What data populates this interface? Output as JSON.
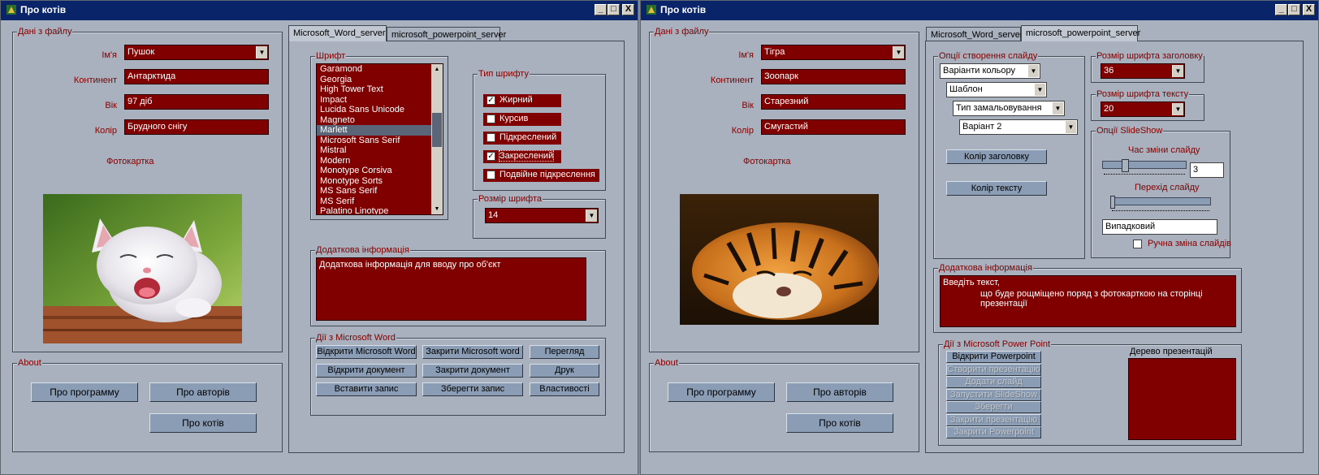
{
  "window_title": "Про котів",
  "window_controls": {
    "minimize": "_",
    "maximize": "□",
    "close": "X"
  },
  "left": {
    "file_group": {
      "title": "Дані з файлу",
      "name_label": "Ім'я",
      "name_value": "Пушок",
      "continent_label": "Континент",
      "continent_value": "Антарктида",
      "age_label": "Вік",
      "age_value": "97 діб",
      "color_label": "Колір",
      "color_value": "Брудного снігу",
      "photo_label": "Фотокартка"
    },
    "about": {
      "title": "About",
      "btn_program": "Про программу",
      "btn_authors": "Про авторів",
      "btn_cats": "Про котів"
    },
    "tabs": [
      "Microsoft_Word_server",
      "microsoft_powerpoint_server"
    ],
    "font_group": {
      "title": "Шрифт",
      "fonts": [
        "Garamond",
        "Georgia",
        "High Tower Text",
        "Impact",
        "Lucida Sans Unicode",
        "Magneto",
        "Marlett",
        "Microsoft Sans Serif",
        "Mistral",
        "Modern",
        "Monotype Corsiva",
        "Monotype Sorts",
        "MS Sans Serif",
        "MS Serif",
        "Palatino Linotype"
      ],
      "selected": "Marlett"
    },
    "font_type": {
      "title": "Тип шрифту",
      "options": [
        {
          "label": "Жирний",
          "checked": true
        },
        {
          "label": "Курсив",
          "checked": false
        },
        {
          "label": "Підкреслений",
          "checked": false
        },
        {
          "label": "Закреслений",
          "checked": true
        },
        {
          "label": "Подвійне підкреслення",
          "checked": false
        }
      ]
    },
    "font_size": {
      "title": "Розмір шрифта",
      "value": "14"
    },
    "extra": {
      "title": "Додаткова інформація",
      "text": "Додаткова інформація для вводу про об'єкт"
    },
    "word_actions": {
      "title": "Дії з Microsoft Word",
      "open_word": "Відкрити Microsoft Word",
      "close_word": "Закрити Microsoft word",
      "preview": "Перегляд",
      "open_doc": "Відкрити документ",
      "close_doc": "Закрити документ",
      "print": "Друк",
      "insert_record": "Вставити запис",
      "save_record": "Зберегти запис",
      "properties": "Властивості"
    }
  },
  "right": {
    "file_group": {
      "title": "Дані з файлу",
      "name_label": "Ім'я",
      "name_value": "Тігра",
      "continent_label": "Континент",
      "continent_value": "Зоопарк",
      "age_label": "Вік",
      "age_value": "Старезний",
      "color_label": "Колір",
      "color_value": "Смугастий",
      "photo_label": "Фотокартка"
    },
    "about": {
      "title": "About",
      "btn_program": "Про программу",
      "btn_authors": "Про авторів",
      "btn_cats": "Про котів"
    },
    "tabs": [
      "Microsoft_Word_server",
      "microsoft_powerpoint_server"
    ],
    "slide_options": {
      "title": "Опції створення слайду",
      "color_variants": "Варіанти кольору",
      "template": "Шаблон",
      "fill_type": "Тип замальовування",
      "variant": "Варіант 2",
      "title_color_btn": "Колір заголовку",
      "text_color_btn": "Колір тексту"
    },
    "title_font_size": {
      "title": "Розмір шрифта заголовку",
      "value": "36"
    },
    "text_font_size": {
      "title": "Розмір шрифта тексту",
      "value": "20"
    },
    "slideshow": {
      "title": "Опції SlideShow",
      "change_time_label": "Час зміни слайду",
      "change_time_value": "3",
      "change_time_level": 0.25,
      "transition_label": "Перехід слайду",
      "transition_level": 0.0,
      "transition_value": "Випадковий",
      "manual_label": "Ручна зміна слайдів"
    },
    "extra": {
      "title": "Додаткова інформація",
      "line1": "Введіть текст,",
      "line2": "що буде рощміщено поряд з фотокарткою на сторінці презентації"
    },
    "ppt_actions": {
      "title": "Дії з Microsoft Power Point",
      "buttons": [
        {
          "label": "Відкрити Powerpoint",
          "enabled": true
        },
        {
          "label": "Створити презентацію",
          "enabled": false
        },
        {
          "label": "Додати слайд",
          "enabled": false
        },
        {
          "label": "Запустити SlideShow",
          "enabled": false
        },
        {
          "label": "Зберегти",
          "enabled": false
        },
        {
          "label": "Закрити презентацію",
          "enabled": false
        },
        {
          "label": "Закрити Powerpoint",
          "enabled": false
        }
      ],
      "tree_label": "Дерево презентацій"
    }
  }
}
